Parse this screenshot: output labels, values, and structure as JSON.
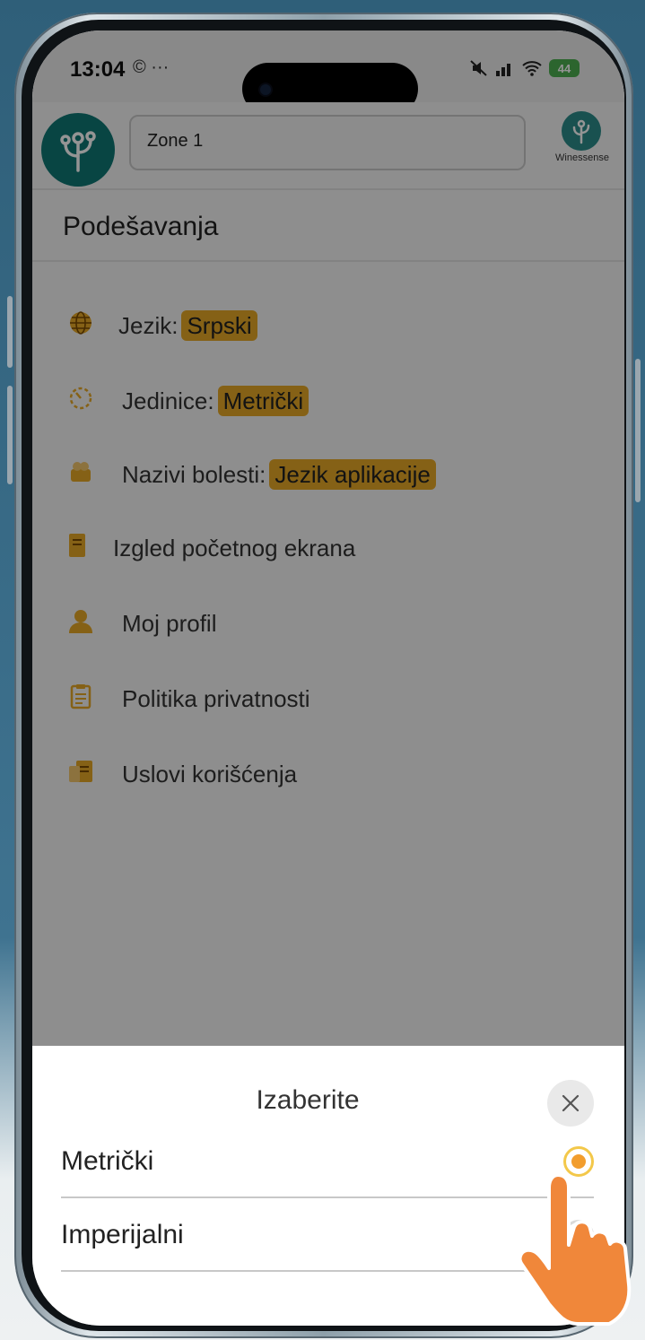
{
  "status_bar": {
    "time": "13:04",
    "extra": "© ···",
    "battery": "44"
  },
  "header": {
    "zone": "Zone 1",
    "brand": "Winessense"
  },
  "page": {
    "title": "Podešavanja"
  },
  "settings": [
    {
      "label": "Jezik:",
      "value": "Srpski",
      "icon": "globe-icon"
    },
    {
      "label": "Jedinice:",
      "value": "Metrički",
      "icon": "gauge-icon"
    },
    {
      "label": "Nazivi bolesti:",
      "value": "Jezik aplikacije",
      "icon": "disease-icon"
    },
    {
      "label": "Izgled početnog ekrana",
      "value": "",
      "icon": "document-icon"
    },
    {
      "label": "Moj profil",
      "value": "",
      "icon": "user-icon"
    },
    {
      "label": "Politika privatnosti",
      "value": "",
      "icon": "clipboard-icon"
    },
    {
      "label": "Uslovi korišćenja",
      "value": "",
      "icon": "terms-icon"
    }
  ],
  "sheet": {
    "title": "Izaberite",
    "options": [
      {
        "label": "Metrički",
        "selected": true
      },
      {
        "label": "Imperijalni",
        "selected": false
      }
    ]
  },
  "colors": {
    "accent": "#e6a826",
    "teal": "#0f7774",
    "hand": "#f0873a"
  }
}
